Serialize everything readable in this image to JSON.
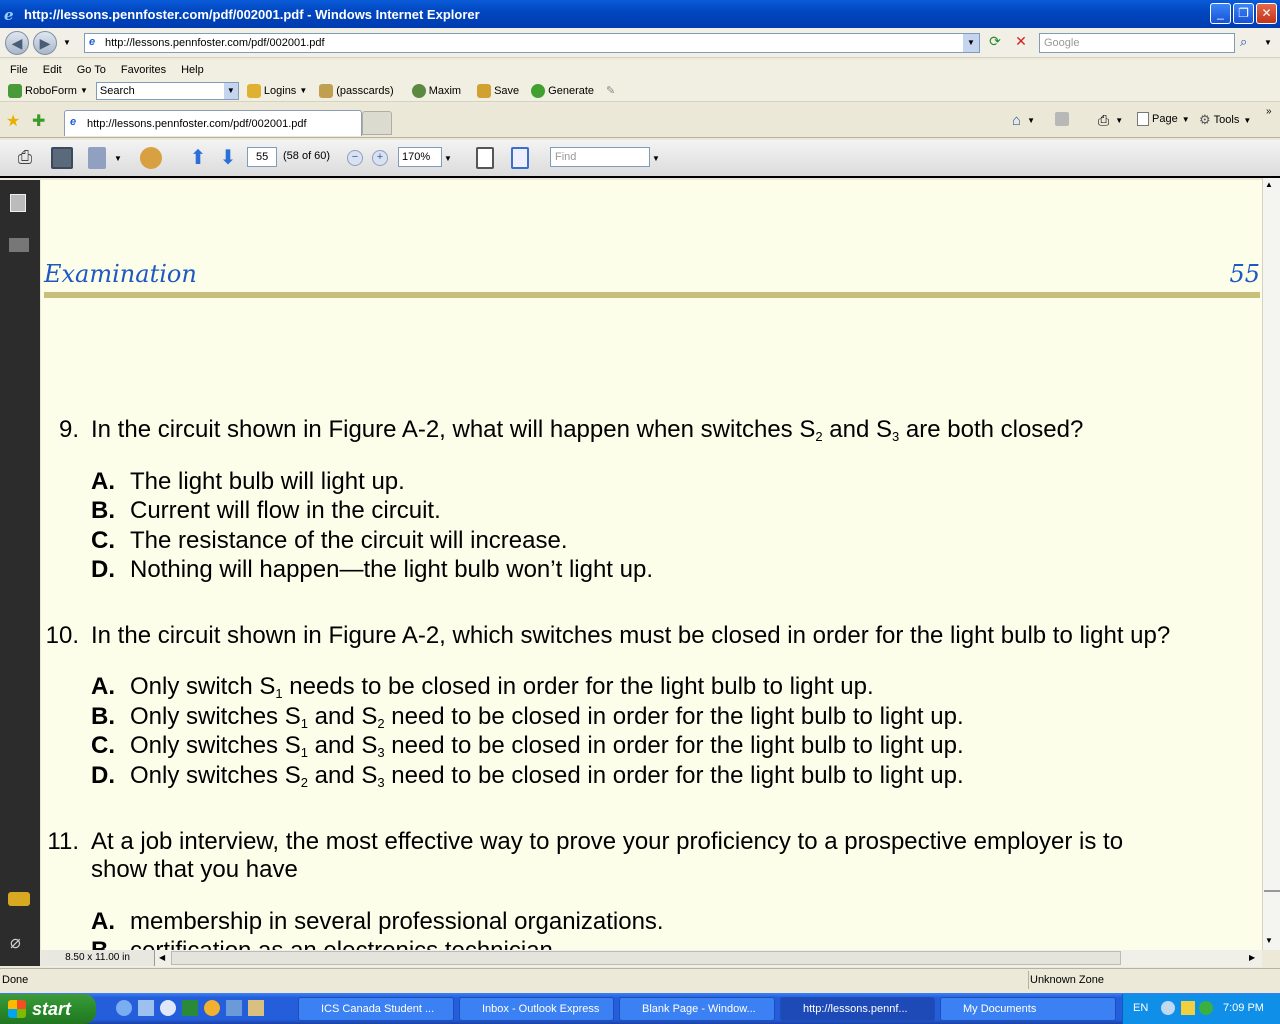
{
  "window": {
    "title": "http://lessons.pennfoster.com/pdf/002001.pdf - Windows Internet Explorer"
  },
  "address": {
    "url": "http://lessons.pennfoster.com/pdf/002001.pdf",
    "search_placeholder": "Google"
  },
  "menu": [
    "File",
    "Edit",
    "Go To",
    "Favorites",
    "Help"
  ],
  "roboform": {
    "label": "RoboForm",
    "search_value": "Search",
    "items": [
      "Logins",
      "(passcards)",
      "Maxim",
      "Save",
      "Generate"
    ]
  },
  "tab": {
    "title": "http://lessons.pennfoster.com/pdf/002001.pdf"
  },
  "commands": [
    "Page",
    "Tools"
  ],
  "pdf_toolbar": {
    "page_number": "55",
    "page_of": "(58 of 60)",
    "zoom": "170%",
    "find_placeholder": "Find"
  },
  "document": {
    "header": "Examination",
    "page_number": "55",
    "questions": [
      {
        "number": "9.",
        "text_parts": [
          "In the circuit shown in Figure A-2, what will happen when switches S",
          "2",
          " and S",
          "3",
          " are both closed?"
        ],
        "options": [
          {
            "letter": "A.",
            "text": "The light bulb will light up."
          },
          {
            "letter": "B.",
            "text": "Current will flow in the circuit."
          },
          {
            "letter": "C.",
            "text": "The resistance of the circuit will increase."
          },
          {
            "letter": "D.",
            "text": "Nothing will happen—the light bulb won’t light up."
          }
        ]
      },
      {
        "number": "10.",
        "text": "In the circuit shown in Figure A-2, which switches must be closed in order for the light bulb to light up?",
        "options": [
          {
            "letter": "A.",
            "parts": [
              "Only switch S",
              "1",
              " needs to be closed in order for the light bulb to light up."
            ]
          },
          {
            "letter": "B.",
            "parts": [
              "Only switches S",
              "1",
              " and S",
              "2",
              " need to be closed in order for the light bulb to light up."
            ]
          },
          {
            "letter": "C.",
            "parts": [
              "Only switches S",
              "1",
              " and S",
              "3",
              " need to be closed in order for the light bulb to light up."
            ]
          },
          {
            "letter": "D.",
            "parts": [
              "Only switches S",
              "2",
              " and S",
              "3",
              " need to be closed in order for the light bulb to light up."
            ]
          }
        ]
      },
      {
        "number": "11.",
        "line1": "At a job interview, the most effective way to prove your proficiency to a prospective employer is to",
        "line2": "show that you have",
        "options": [
          {
            "letter": "A.",
            "text": "membership in several professional organizations."
          },
          {
            "letter": "B.",
            "text": "certification as an electronics technician."
          }
        ]
      }
    ],
    "page_size": "8.50 x 11.00 in"
  },
  "status": {
    "left": "Done",
    "zone": "Unknown Zone"
  },
  "taskbar": {
    "start": "start",
    "buttons": [
      "ICS Canada Student ...",
      "Inbox - Outlook Express",
      "Blank Page - Window...",
      "http://lessons.pennf...",
      "My Documents"
    ],
    "lang": "EN",
    "clock": "7:09 PM"
  }
}
